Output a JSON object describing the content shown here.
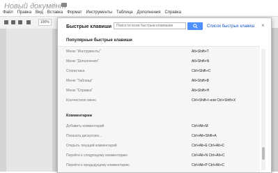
{
  "document": {
    "title": "Новый документ",
    "menus": [
      "Файл",
      "Правка",
      "Вид",
      "Вставка",
      "Формат",
      "Инструменты",
      "Таблица",
      "Дополнения",
      "Справка"
    ],
    "zoom": "100%"
  },
  "dialog": {
    "title": "Быстрые клавиши",
    "search_placeholder": "Поиск по всем быстрым клавишам",
    "all_link": "Список быстрых клавиш",
    "close": "×",
    "popular_heading": "Популярные быстрые клавиши",
    "rows": [
      {
        "name": "Меню \"Инструменты\"",
        "keys": "Alt+Shift+T"
      },
      {
        "name": "Меню \"Дополнения\"",
        "keys": "Alt+Shift+N"
      },
      {
        "name": "Статистика",
        "keys": "Ctrl+Shift+C"
      },
      {
        "name": "Меню \"Таблица\"",
        "keys": "Alt+Shift+B"
      },
      {
        "name": "Меню \"Справка\"",
        "keys": "Alt+Shift+H"
      },
      {
        "name": "Контекстное меню",
        "keys": "Ctrl+Shift+\\ или Ctrl+Shift+X"
      }
    ],
    "comments_heading": "Комментарии",
    "comment_rows": [
      {
        "name": "Добавить комментарий",
        "keys": "Ctrl+Alt+M"
      },
      {
        "name": "Показать дискуссию...",
        "keys": "Ctrl+Alt+Shift+A"
      },
      {
        "name": "Открыть текущий комментарий",
        "keys": "Ctrl+Alt+E Ctrl+Alt+C"
      },
      {
        "name": "Перейти к следующему комментарию",
        "keys": "Ctrl+Alt+N Ctrl+Alt+C"
      },
      {
        "name": "Перейти к предыдущему комментарию",
        "keys": "Ctrl+Alt+P Ctrl+Alt+C"
      }
    ]
  }
}
